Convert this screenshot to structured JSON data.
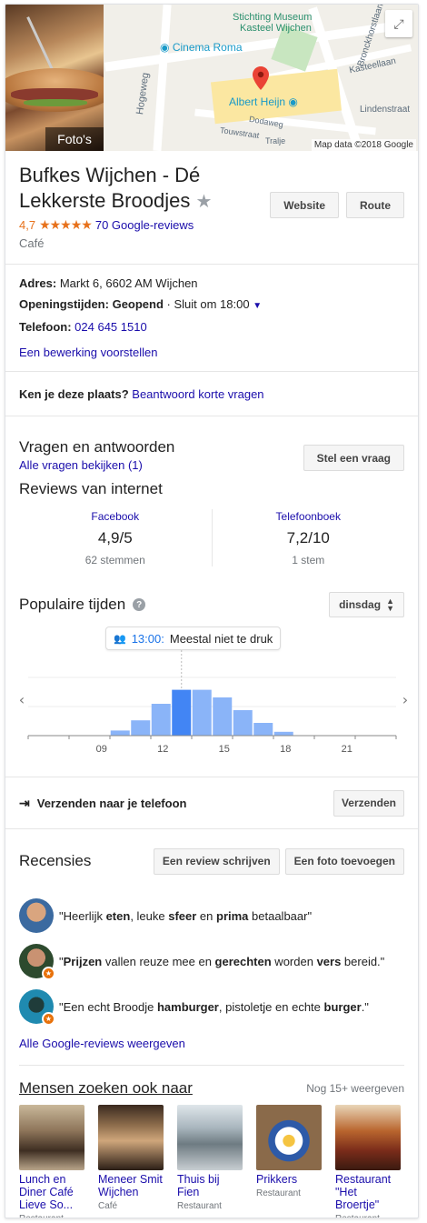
{
  "hero": {
    "photo_label": "Foto's",
    "map": {
      "labels": [
        "Stichting Museum",
        "Kasteel Wijchen",
        "Cinema Roma",
        "Albert Heijn",
        "Hogeweg",
        "Bronckhorstlaan",
        "Kasteellaan",
        "Lindenstraat",
        "Dodaweg",
        "Touwstraat",
        "Tralje"
      ],
      "copyright": "Map data ©2018 Google"
    }
  },
  "place": {
    "title": "Bufkes Wijchen - Dé Lekkerste Broodjes",
    "rating": "4,7",
    "stars": "★★★★★",
    "reviews_link": "70 Google-reviews",
    "category": "Café",
    "website_btn": "Website",
    "route_btn": "Route"
  },
  "info": {
    "address_label": "Adres:",
    "address": "Markt 6, 6602 AM Wijchen",
    "hours_label": "Openingstijden:",
    "hours_status": "Geopend",
    "hours_detail": "· Sluit om 18:00",
    "phone_label": "Telefoon:",
    "phone": "024 645 1510",
    "suggest": "Een bewerking voorstellen"
  },
  "know": {
    "question": "Ken je deze plaats?",
    "link": "Beantwoord korte vragen"
  },
  "qa": {
    "title": "Vragen en antwoorden",
    "link": "Alle vragen bekijken (1)",
    "button": "Stel een vraag"
  },
  "web_reviews": {
    "title": "Reviews van internet",
    "items": [
      {
        "source": "Facebook",
        "score": "4,9/5",
        "votes": "62 stemmen"
      },
      {
        "source": "Telefoonboek",
        "score": "7,2/10",
        "votes": "1 stem"
      }
    ]
  },
  "popular": {
    "title": "Populaire tijden",
    "day": "dinsdag",
    "tooltip_time": "13:00:",
    "tooltip_text": "Meestal niet te druk",
    "colors": {
      "bar": "#8ab4f8",
      "current": "#4285f4"
    }
  },
  "chart_data": {
    "type": "bar",
    "categories": [
      "06",
      "07",
      "08",
      "09",
      "10",
      "11",
      "12",
      "13",
      "14",
      "15",
      "16",
      "17",
      "18",
      "19",
      "20",
      "21",
      "22",
      "23"
    ],
    "values": [
      0,
      0,
      0,
      0,
      4,
      12,
      25,
      36,
      36,
      30,
      20,
      10,
      3,
      0,
      0,
      0,
      0,
      0
    ],
    "highlight_index": 7,
    "tick_labels": [
      "09",
      "12",
      "15",
      "18",
      "21"
    ],
    "tick_indices": [
      3,
      6,
      9,
      12,
      15
    ],
    "ylim": [
      0,
      50
    ]
  },
  "send": {
    "label": "Verzenden naar je telefoon",
    "button": "Verzenden"
  },
  "reviews": {
    "title": "Recensies",
    "write_btn": "Een review schrijven",
    "photo_btn": "Een foto toevoegen",
    "items": [
      {
        "parts": [
          "\"Heerlijk ",
          "eten",
          ", leuke ",
          "sfeer",
          " en ",
          "prima",
          " betaalbaar\""
        ]
      },
      {
        "parts": [
          "\"",
          "Prijzen",
          " vallen reuze mee en ",
          "gerechten",
          " worden ",
          "vers",
          " bereid.\""
        ]
      },
      {
        "parts": [
          "\"Een echt Broodje ",
          "hamburger",
          ", pistoletje en echte ",
          "burger",
          ".\""
        ]
      }
    ],
    "all_link": "Alle Google-reviews weergeven"
  },
  "people": {
    "title": "Mensen zoeken ook naar",
    "more": "Nog 15+ weergeven",
    "items": [
      {
        "name": "Lunch en Diner Café Lieve So...",
        "type": "Restaurant"
      },
      {
        "name": "Meneer Smit Wijchen",
        "type": "Café"
      },
      {
        "name": "Thuis bij Fien",
        "type": "Restaurant"
      },
      {
        "name": "Prikkers",
        "type": "Restaurant"
      },
      {
        "name": "Restaurant \"Het Broertje\"",
        "type": "Restaurant"
      }
    ]
  }
}
